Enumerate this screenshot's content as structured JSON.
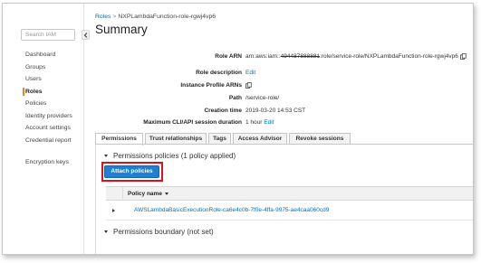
{
  "sidebar": {
    "search_placeholder": "Search IAM",
    "items": [
      {
        "label": "Dashboard"
      },
      {
        "label": "Groups"
      },
      {
        "label": "Users"
      },
      {
        "label": "Roles",
        "active": true
      },
      {
        "label": "Policies"
      },
      {
        "label": "Identity providers"
      },
      {
        "label": "Account settings"
      },
      {
        "label": "Credential report"
      }
    ],
    "bottom_items": [
      {
        "label": "Encryption keys"
      }
    ]
  },
  "breadcrumb": {
    "root": "Roles",
    "separator": ">",
    "current": "NXPLambdaFunction-role-rgwj4vp6"
  },
  "page_title": "Summary",
  "details": {
    "role_arn_label": "Role ARN",
    "role_arn_prefix": "arn:aws:iam::",
    "role_arn_account_redacted": "494487888881",
    "role_arn_suffix": ":role/service-role/NXPLambdaFunction-role-rgwj4vp6",
    "role_description_label": "Role description",
    "role_description_value": "Edit",
    "instance_profile_label": "Instance Profile ARNs",
    "path_label": "Path",
    "path_value": "/service-role/",
    "creation_time_label": "Creation time",
    "creation_time_value": "2019-03-20 14:53 CST",
    "max_session_label": "Maximum CLI/API session duration",
    "max_session_value": "1 hour",
    "max_session_edit": "Edit"
  },
  "tabs": [
    {
      "label": "Permissions",
      "active": true
    },
    {
      "label": "Trust relationships"
    },
    {
      "label": "Tags"
    },
    {
      "label": "Access Advisor"
    },
    {
      "label": "Revoke sessions"
    }
  ],
  "permissions": {
    "policies_heading": "Permissions policies (1 policy applied)",
    "attach_button": "Attach policies",
    "column_policy_name": "Policy name",
    "policies": [
      {
        "name": "AWSLambdaBasicExecutionRole-ca6e4c0b-7f0e-4ffa-9975-ae4caa060cd9"
      }
    ],
    "boundary_heading": "Permissions boundary (not set)"
  },
  "colors": {
    "link": "#0073bb",
    "primary_button": "#1f7fd2",
    "highlight_outline": "#e0101a",
    "active_nav_marker": "#e7861f"
  }
}
